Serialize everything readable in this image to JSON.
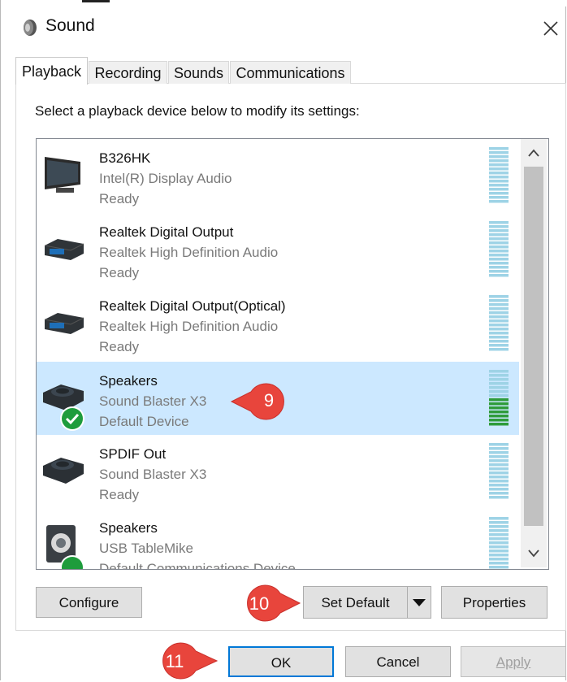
{
  "window": {
    "title": "Sound"
  },
  "tabs": [
    {
      "label": "Playback"
    },
    {
      "label": "Recording"
    },
    {
      "label": "Sounds"
    },
    {
      "label": "Communications"
    }
  ],
  "instruction": "Select a playback device below to modify its settings:",
  "devices": [
    {
      "name": "B326HK",
      "driver": "Intel(R) Display Audio",
      "status": "Ready",
      "icon": "monitor-icon",
      "selected": false
    },
    {
      "name": "Realtek Digital Output",
      "driver": "Realtek High Definition Audio",
      "status": "Ready",
      "icon": "digital-output-icon",
      "selected": false
    },
    {
      "name": "Realtek Digital Output(Optical)",
      "driver": "Realtek High Definition Audio",
      "status": "Ready",
      "icon": "optical-output-icon",
      "selected": false
    },
    {
      "name": "Speakers",
      "driver": "Sound Blaster X3",
      "status": "Default Device",
      "icon": "speakers-icon",
      "selected": true,
      "default_check": true,
      "meter_level": 0.5
    },
    {
      "name": "SPDIF Out",
      "driver": "Sound Blaster X3",
      "status": "Ready",
      "icon": "spdif-icon",
      "selected": false
    },
    {
      "name": "Speakers",
      "driver": "USB TableMike",
      "status": "Default Communications Device",
      "icon": "usb-speakers-icon",
      "selected": false
    }
  ],
  "buttons": {
    "configure": "Configure",
    "set_default": "Set Default",
    "properties": "Properties",
    "ok": "OK",
    "cancel": "Cancel",
    "apply": "Apply"
  },
  "callouts": {
    "c9": "9",
    "c10": "10",
    "c11": "11"
  },
  "colors": {
    "selected_bg": "#cce8ff",
    "meter_idle": "#9ed3e6",
    "meter_active": "#2e9b3a",
    "callout": "#e8453c",
    "ok_border": "#0078d7"
  }
}
